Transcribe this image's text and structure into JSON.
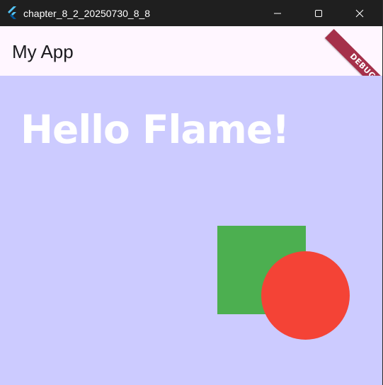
{
  "window": {
    "title": "chapter_8_2_20250730_8_8",
    "controls": {
      "minimize_icon": "minimize-icon",
      "maximize_icon": "maximize-icon",
      "close_icon": "close-icon"
    }
  },
  "appbar": {
    "title": "My App",
    "debug_banner": "DEBUG"
  },
  "game": {
    "text": "Hello Flame!",
    "background_color": "#cccbff",
    "square_color": "#4caf50",
    "circle_color": "#f44336"
  },
  "colors": {
    "titlebar": "#1f1f1f",
    "appbar": "#fff6ff",
    "debug_banner": "#a5304a"
  }
}
